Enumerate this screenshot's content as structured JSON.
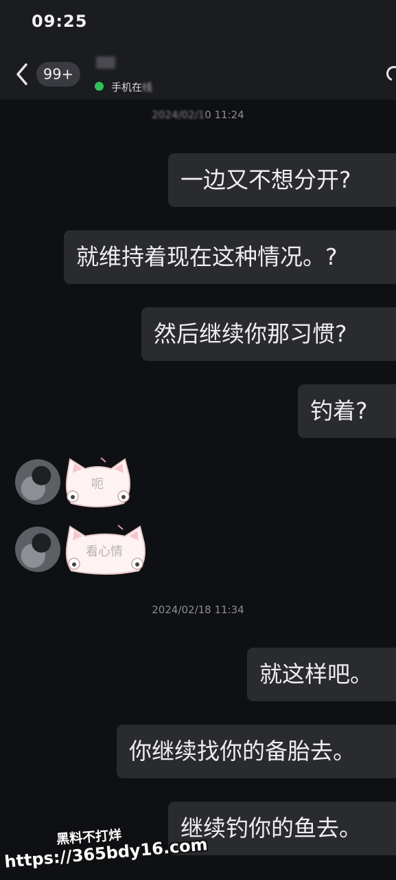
{
  "status_bar": {
    "time": "09:25"
  },
  "header": {
    "unread_count": "99+",
    "online_status": "手机在",
    "online_status_obscured": "线",
    "colors": {
      "online_dot": "#2fc05a",
      "background": "#1b1c20"
    }
  },
  "conversation": {
    "timestamp_1_visible": "0 11:24",
    "timestamp_1_obscured": "2024/02/1",
    "outgoing_block_1": [
      "一边又不想分开?",
      "就维持着现在这种情况。?",
      "然后继续你那习惯?",
      "钓着?"
    ],
    "incoming_stickers": [
      {
        "text": "呃",
        "icon": "cat-sticker-icon"
      },
      {
        "text": "看心情",
        "icon": "cat-sticker-icon"
      }
    ],
    "timestamp_2": "2024/02/18 11:34",
    "outgoing_block_2": [
      "就这样吧。",
      "你继续找你的备胎去。",
      "继续钓你的鱼去。"
    ]
  },
  "watermark": {
    "line1": "黑料不打烊",
    "line2": "https://365bdy16.com"
  },
  "colors": {
    "page_background": "#0f1013",
    "bubble_background": "#2a2b2f",
    "text_primary": "#eeeef0",
    "text_muted": "#8c8d92"
  }
}
